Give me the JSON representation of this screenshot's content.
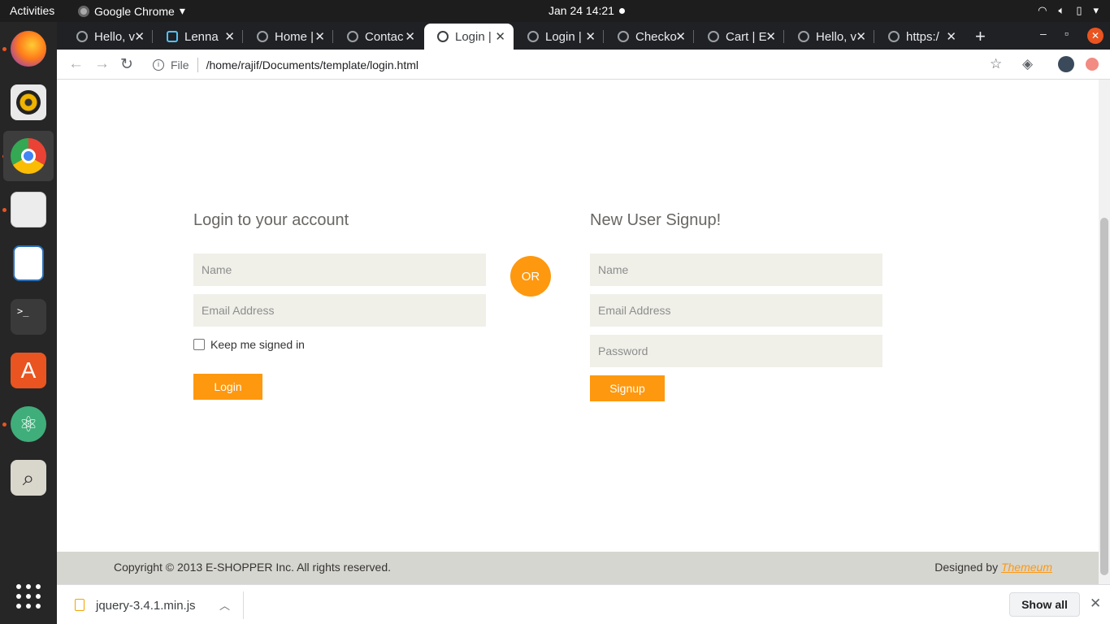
{
  "topbar": {
    "activities": "Activities",
    "app_name": "Google Chrome",
    "clock": "Jan 24  14:21"
  },
  "dock": {
    "apps": [
      "Firefox",
      "Rhythmbox",
      "Google Chrome",
      "Files",
      "LibreOffice Writer",
      "Terminal",
      "Ubuntu Software",
      "Atom",
      "Document Viewer",
      "Show Applications"
    ]
  },
  "tabs": [
    {
      "title": "Hello, v"
    },
    {
      "title": "Lenna"
    },
    {
      "title": "Home |"
    },
    {
      "title": "Contac"
    },
    {
      "title": "Login |"
    },
    {
      "title": "Login |"
    },
    {
      "title": "Checko"
    },
    {
      "title": "Cart | E"
    },
    {
      "title": "Hello, v"
    },
    {
      "title": "https:/"
    }
  ],
  "address": {
    "scheme": "File",
    "url": "/home/rajif/Documents/template/login.html"
  },
  "login": {
    "title": "Login to your account",
    "name_placeholder": "Name",
    "email_placeholder": "Email Address",
    "keep_signed": "Keep me signed in",
    "button": "Login"
  },
  "or_label": "OR",
  "signup": {
    "title": "New User Signup!",
    "name_placeholder": "Name",
    "email_placeholder": "Email Address",
    "password_placeholder": "Password",
    "button": "Signup"
  },
  "footer": {
    "copyright": "Copyright © 2013 E-SHOPPER Inc. All rights reserved.",
    "designed_prefix": "Designed by ",
    "designed_link": "Themeum"
  },
  "downloads": {
    "file": "jquery-3.4.1.min.js",
    "show_all": "Show all"
  },
  "colors": {
    "accent": "#FE980F",
    "input_bg": "#F0F0E9",
    "footer_bg": "#D6D6D0"
  }
}
